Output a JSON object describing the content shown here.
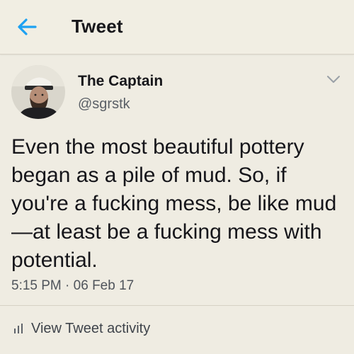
{
  "header": {
    "title": "Tweet",
    "back_icon": "arrow-left-icon",
    "accent_color": "#1da1f2"
  },
  "tweet": {
    "author": {
      "display_name": "The Captain",
      "handle": "@sgrstk",
      "avatar_icon": "profile-photo"
    },
    "menu_icon": "chevron-down-icon",
    "text": "Even the most beautiful pottery began as a pile of mud. So, if you're a fucking mess, be like mud—at least be a fucking mess with potential.",
    "time": "5:15 PM",
    "separator": "·",
    "date": "06 Feb 17"
  },
  "activity": {
    "icon": "bar-chart-icon",
    "label": "View Tweet activity"
  }
}
